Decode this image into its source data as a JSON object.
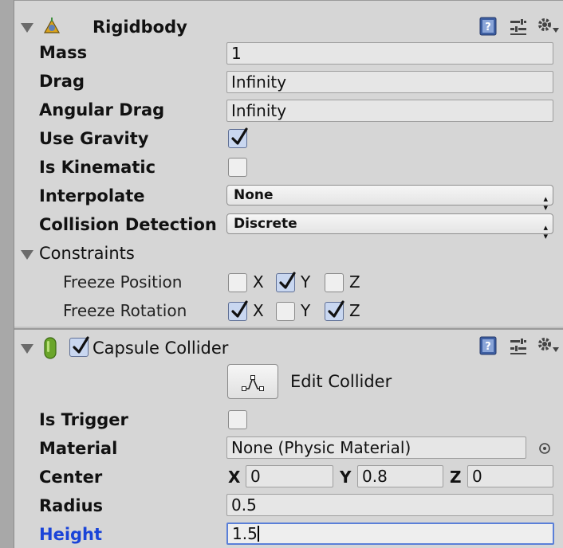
{
  "rigidbody": {
    "title": "Rigidbody",
    "fields": {
      "mass_label": "Mass",
      "mass_value": "1",
      "drag_label": "Drag",
      "drag_value": "Infinity",
      "angular_drag_label": "Angular Drag",
      "angular_drag_value": "Infinity",
      "use_gravity_label": "Use Gravity",
      "use_gravity_checked": true,
      "is_kinematic_label": "Is Kinematic",
      "is_kinematic_checked": false,
      "interpolate_label": "Interpolate",
      "interpolate_value": "None",
      "collision_detection_label": "Collision Detection",
      "collision_detection_value": "Discrete"
    },
    "constraints": {
      "label": "Constraints",
      "freeze_position_label": "Freeze Position",
      "freeze_position": {
        "x_label": "X",
        "x": false,
        "y_label": "Y",
        "y": true,
        "z_label": "Z",
        "z": false
      },
      "freeze_rotation_label": "Freeze Rotation",
      "freeze_rotation": {
        "x_label": "X",
        "x": true,
        "y_label": "Y",
        "y": false,
        "z_label": "Z",
        "z": true
      }
    }
  },
  "capsule_collider": {
    "title": "Capsule Collider",
    "enabled": true,
    "edit_collider_label": "Edit Collider",
    "fields": {
      "is_trigger_label": "Is Trigger",
      "is_trigger_checked": false,
      "material_label": "Material",
      "material_value": "None (Physic Material)",
      "center_label": "Center",
      "center": {
        "x_label": "X",
        "x": "0",
        "y_label": "Y",
        "y": "0.8",
        "z_label": "Z",
        "z": "0"
      },
      "radius_label": "Radius",
      "radius_value": "0.5",
      "height_label": "Height",
      "height_value": "1.5"
    }
  },
  "icons": {
    "fold": "fold-triangle-icon",
    "rigidbody": "rigidbody-icon",
    "capsule": "capsule-collider-icon",
    "help": "help-book-icon",
    "preset": "preset-sliders-icon",
    "settings": "gear-menu-icon",
    "edit_collider": "edit-collider-icon",
    "object_picker": "object-picker-icon"
  },
  "colors": {
    "highlight_label": "#1a44d8",
    "focus_border": "#5a7fd8",
    "panel_bg": "#d6d6d6"
  }
}
